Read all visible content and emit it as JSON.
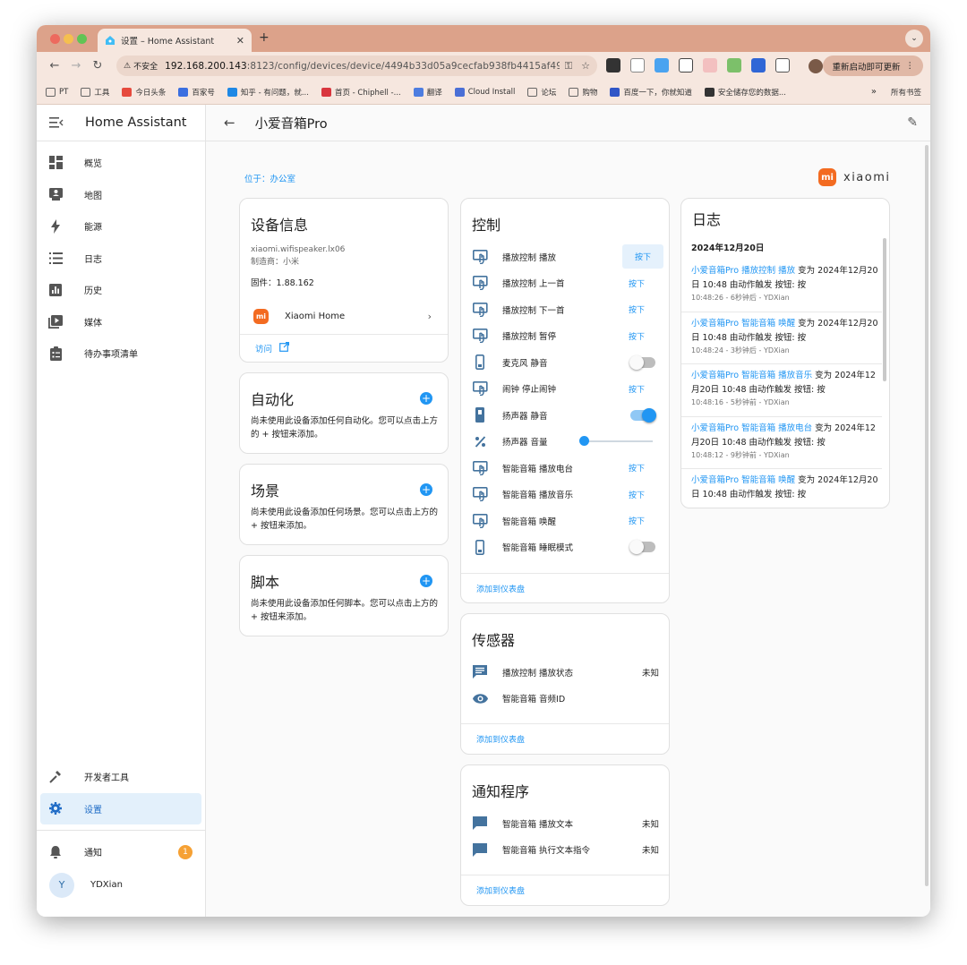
{
  "browser": {
    "tab_title": "设置 – Home Assistant",
    "security_label": "不安全",
    "url_host": "192.168.200.143",
    "url_path": ":8123/config/devices/device/4494b33d05a9cecfab938fb4415af49c",
    "restart_label": "重新启动即可更新",
    "bookmarks": [
      "PT",
      "工具",
      "今日头条",
      "百家号",
      "知乎 - 有问题，就...",
      "首页 - Chiphell -...",
      "翻译",
      "Cloud Install",
      "论坛",
      "购物",
      "百度一下，你就知道",
      "安全储存您的数据..."
    ],
    "bookmarks_more": "»",
    "bookmarks_all": "所有书签"
  },
  "sidebar": {
    "title": "Home Assistant",
    "items": [
      {
        "label": "概览",
        "icon": "dashboard-icon"
      },
      {
        "label": "地图",
        "icon": "map-icon"
      },
      {
        "label": "能源",
        "icon": "lightning-icon"
      },
      {
        "label": "日志",
        "icon": "logbook-icon"
      },
      {
        "label": "历史",
        "icon": "history-chart-icon"
      },
      {
        "label": "媒体",
        "icon": "media-icon"
      },
      {
        "label": "待办事项清单",
        "icon": "clipboard-list-icon"
      }
    ],
    "dev_tools": "开发者工具",
    "settings": "设置",
    "notifications": "通知",
    "notification_count": "1",
    "user_initial": "Y",
    "user_name": "YDXian",
    "accent": "#2196f3"
  },
  "header": {
    "title": "小爱音箱Pro"
  },
  "area": "位于：办公室",
  "brand": {
    "mark": "mi",
    "name": "xiaomi"
  },
  "device_info": {
    "title": "设备信息",
    "model": "xiaomi.wifispeaker.lx06",
    "manufacturer": "制造商：小米",
    "firmware": "固件：1.88.162",
    "integration": "Xiaomi Home",
    "visit": "访问"
  },
  "automation": {
    "title": "自动化",
    "desc": "尚未使用此设备添加任何自动化。您可以点击上方的 + 按钮来添加。"
  },
  "scene": {
    "title": "场景",
    "desc": "尚未使用此设备添加任何场景。您可以点击上方的 + 按钮来添加。"
  },
  "script": {
    "title": "脚本",
    "desc": "尚未使用此设备添加任何脚本。您可以点击上方的 + 按钮来添加。"
  },
  "controls": {
    "title": "控制",
    "press_label": "按下",
    "entities": [
      {
        "name": "播放控制 播放",
        "kind": "button",
        "icon": "gesture-tap-icon"
      },
      {
        "name": "播放控制 上一首",
        "kind": "button",
        "icon": "gesture-tap-icon"
      },
      {
        "name": "播放控制 下一首",
        "kind": "button",
        "icon": "gesture-tap-icon"
      },
      {
        "name": "播放控制 暂停",
        "kind": "button",
        "icon": "gesture-tap-icon"
      },
      {
        "name": "麦克风 静音",
        "kind": "switch",
        "on": false,
        "icon": "switch-icon"
      },
      {
        "name": "闹钟 停止闹钟",
        "kind": "button",
        "icon": "gesture-tap-icon"
      },
      {
        "name": "扬声器 静音",
        "kind": "switch",
        "on": true,
        "icon": "switch-icon"
      },
      {
        "name": "扬声器 音量",
        "kind": "slider",
        "value": 0,
        "icon": "percent-icon"
      },
      {
        "name": "智能音箱 播放电台",
        "kind": "button",
        "icon": "gesture-tap-icon"
      },
      {
        "name": "智能音箱 播放音乐",
        "kind": "button",
        "icon": "gesture-tap-icon"
      },
      {
        "name": "智能音箱 唤醒",
        "kind": "button",
        "icon": "gesture-tap-icon"
      },
      {
        "name": "智能音箱 睡眠模式",
        "kind": "switch",
        "on": false,
        "icon": "switch-icon"
      }
    ],
    "add_to_dashboard": "添加到仪表盘"
  },
  "sensors": {
    "title": "传感器",
    "entities": [
      {
        "name": "播放控制 播放状态",
        "state": "未知",
        "icon": "message-text-icon"
      },
      {
        "name": "智能音箱 音频ID",
        "state": "",
        "icon": "eye-icon"
      }
    ],
    "add_to_dashboard": "添加到仪表盘"
  },
  "notify": {
    "title": "通知程序",
    "entities": [
      {
        "name": "智能音箱 播放文本",
        "state": "未知",
        "icon": "message-icon"
      },
      {
        "name": "智能音箱 执行文本指令",
        "state": "未知",
        "icon": "message-icon"
      }
    ],
    "add_to_dashboard": "添加到仪表盘"
  },
  "logbook": {
    "title": "日志",
    "date": "2024年12月20日",
    "entries": [
      {
        "link": "小爱音箱Pro 播放控制 播放",
        "text": " 变为 2024年12月20日 10:48 由动作触发 按钮: 按",
        "meta": "10:48:26 - 6秒钟后 - YDXian"
      },
      {
        "link": "小爱音箱Pro 智能音箱 唤醒",
        "text": " 变为 2024年12月20日 10:48 由动作触发 按钮: 按",
        "meta": "10:48:24 - 3秒钟后 - YDXian"
      },
      {
        "link": "小爱音箱Pro 智能音箱 播放音乐",
        "text": " 变为 2024年12月20日 10:48 由动作触发 按钮: 按",
        "meta": "10:48:16 - 5秒钟前 - YDXian"
      },
      {
        "link": "小爱音箱Pro 智能音箱 播放电台",
        "text": " 变为 2024年12月20日 10:48 由动作触发 按钮: 按",
        "meta": "10:48:12 - 9秒钟前 - YDXian"
      },
      {
        "link": "小爱音箱Pro 智能音箱 唤醒",
        "text": " 变为 2024年12月20日 10:48 由动作触发 按钮: 按",
        "meta": ""
      }
    ]
  }
}
